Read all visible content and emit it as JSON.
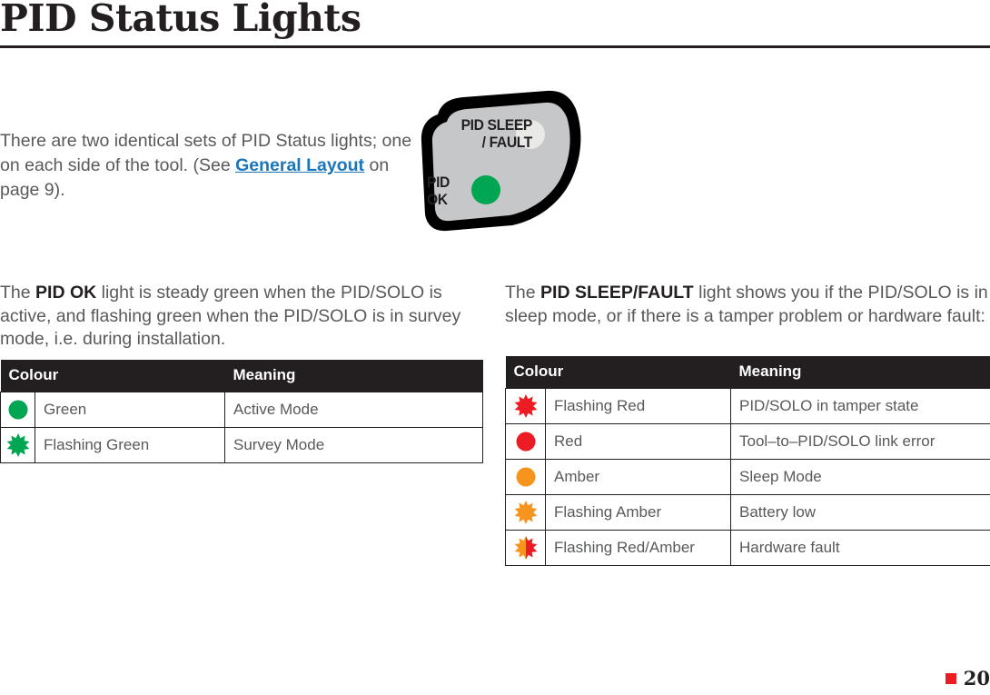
{
  "page": {
    "title": "PID Status Lights",
    "footer_page_number": "20",
    "marker_color": "#ed1c24"
  },
  "intro": {
    "text_before": "There are two identical sets of PID Status lights; one on each side of the tool. (See ",
    "link_text": "General Layout",
    "link_color": "#1b75bb",
    "text_after": " on page 9)."
  },
  "illustration": {
    "name": "pid-status-light-panel",
    "panel_fill": "#c6c7c9",
    "panel_outline": "#000000",
    "labels": {
      "sleep_line1": "PID SLEEP",
      "sleep_line2": "/ FAULT",
      "ok_line1": "PID",
      "ok_line2": "OK"
    },
    "leds": {
      "sleep_fault_color": "#e9e9e7",
      "pid_ok_color": "#00a651"
    }
  },
  "left_section": {
    "paragraph": {
      "before": "The ",
      "bold": "PID OK",
      "after": " light is steady green when the PID/SOLO is active, and flashing green when the PID/SOLO is in survey mode, i.e. during installation."
    },
    "table": {
      "headers": [
        "Colour",
        "Meaning"
      ],
      "rows": [
        {
          "icon": "solid-circle-green-icon",
          "color": "#00a651",
          "style": "circle",
          "colour": "Green",
          "meaning": "Active Mode"
        },
        {
          "icon": "flashing-starburst-green-icon",
          "color": "#00a651",
          "style": "burst",
          "colour": "Flashing Green",
          "meaning": "Survey Mode"
        }
      ]
    }
  },
  "right_section": {
    "paragraph": {
      "before": "The ",
      "bold": "PID SLEEP/FAULT",
      "after": " light shows you if the PID/SOLO is in sleep mode, or if there is a tamper problem or hardware fault:"
    },
    "table": {
      "headers": [
        "Colour",
        "Meaning"
      ],
      "rows": [
        {
          "icon": "flashing-starburst-red-icon",
          "color": "#ed1c24",
          "style": "burst",
          "colour": "Flashing Red",
          "meaning": "PID/SOLO in tamper state"
        },
        {
          "icon": "solid-circle-red-icon",
          "color": "#ed1c24",
          "style": "circle",
          "colour": "Red",
          "meaning": "Tool–to–PID/SOLO link error"
        },
        {
          "icon": "solid-circle-amber-icon",
          "color": "#f7941e",
          "style": "circle",
          "colour": "Amber",
          "meaning": "Sleep Mode"
        },
        {
          "icon": "flashing-starburst-amber-icon",
          "color": "#f7941e",
          "style": "burst",
          "colour": "Flashing Amber",
          "meaning": "Battery low"
        },
        {
          "icon": "flashing-starburst-red-amber-icon",
          "color": "#f7941e",
          "color2": "#ed1c24",
          "style": "burst-split",
          "colour": "Flashing Red/Amber",
          "meaning": "Hardware fault"
        }
      ]
    }
  }
}
